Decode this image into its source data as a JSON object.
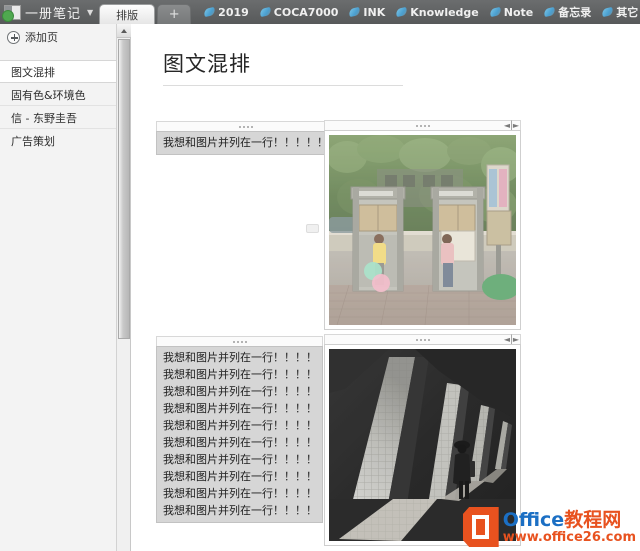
{
  "app": {
    "name": "一册笔记",
    "caret": "▼",
    "logo_icon": "notebook-logo-icon"
  },
  "tabs": {
    "active": "排版",
    "add_label": "+",
    "quicklinks": [
      {
        "label": "2019",
        "icon": "ribbon-icon"
      },
      {
        "label": "COCA7000",
        "icon": "ribbon-icon"
      },
      {
        "label": "INK",
        "icon": "ribbon-icon"
      },
      {
        "label": "Knowledge",
        "icon": "ribbon-icon"
      },
      {
        "label": "Note",
        "icon": "ribbon-icon"
      },
      {
        "label": "备忘录",
        "icon": "ribbon-icon"
      },
      {
        "label": "其它",
        "icon": "ribbon-icon"
      }
    ]
  },
  "sidebar": {
    "add_page_label": "添加页",
    "add_page_icon": "plus-circle-icon",
    "scroll_up_icon": "scroll-up-arrow-icon",
    "pages": [
      {
        "label": "图文混排",
        "selected": true,
        "chevron": ""
      },
      {
        "label": "固有色&环境色",
        "selected": false,
        "chevron": "⌄"
      },
      {
        "label": "信 - 东野圭吾",
        "selected": false,
        "chevron": "⌄"
      },
      {
        "label": "广告策划",
        "selected": false,
        "chevron": ""
      }
    ]
  },
  "note": {
    "title": "图文混排",
    "blocks": [
      {
        "type": "text",
        "name": "text-block-top",
        "grip_icon": "drag-grip-icon",
        "lines": [
          "我想和图片并列在一行！！！！！！"
        ]
      },
      {
        "type": "image",
        "name": "image-block-phonebooths",
        "grip_icon": "drag-grip-icon",
        "resize_icon": "resize-horizontal-icon",
        "alt": "两个公用电话亭与孩子气球照片"
      },
      {
        "type": "text",
        "name": "text-block-bottom",
        "grip_icon": "drag-grip-icon",
        "lines": [
          "我想和图片并列在一行！！！！",
          "我想和图片并列在一行！！！！",
          "我想和图片并列在一行！！！！",
          "我想和图片并列在一行！！！！",
          "我想和图片并列在一行！！！！",
          "我想和图片并列在一行！！！！",
          "我想和图片并列在一行！！！！",
          "我想和图片并列在一行！！！！",
          "我想和图片并列在一行！！！！",
          "我想和图片并列在一行！！！！"
        ]
      },
      {
        "type": "image",
        "name": "image-block-corridor",
        "grip_icon": "drag-grip-icon",
        "resize_icon": "resize-horizontal-icon",
        "alt": "黑白建筑长廊光影人物照片"
      }
    ]
  },
  "watermark": {
    "brand_en": "Office",
    "brand_cn": "教程网",
    "url": "www.office26.com",
    "badge_icon": "office-logo-icon",
    "color_orange": "#e8521f",
    "color_blue": "#1b6fc4"
  },
  "colors": {
    "titlebar": "#616364",
    "sidebar_bg": "#f3f3f3",
    "text_block_bg": "#d6d6d6",
    "canvas_bg": "#ffffff"
  }
}
